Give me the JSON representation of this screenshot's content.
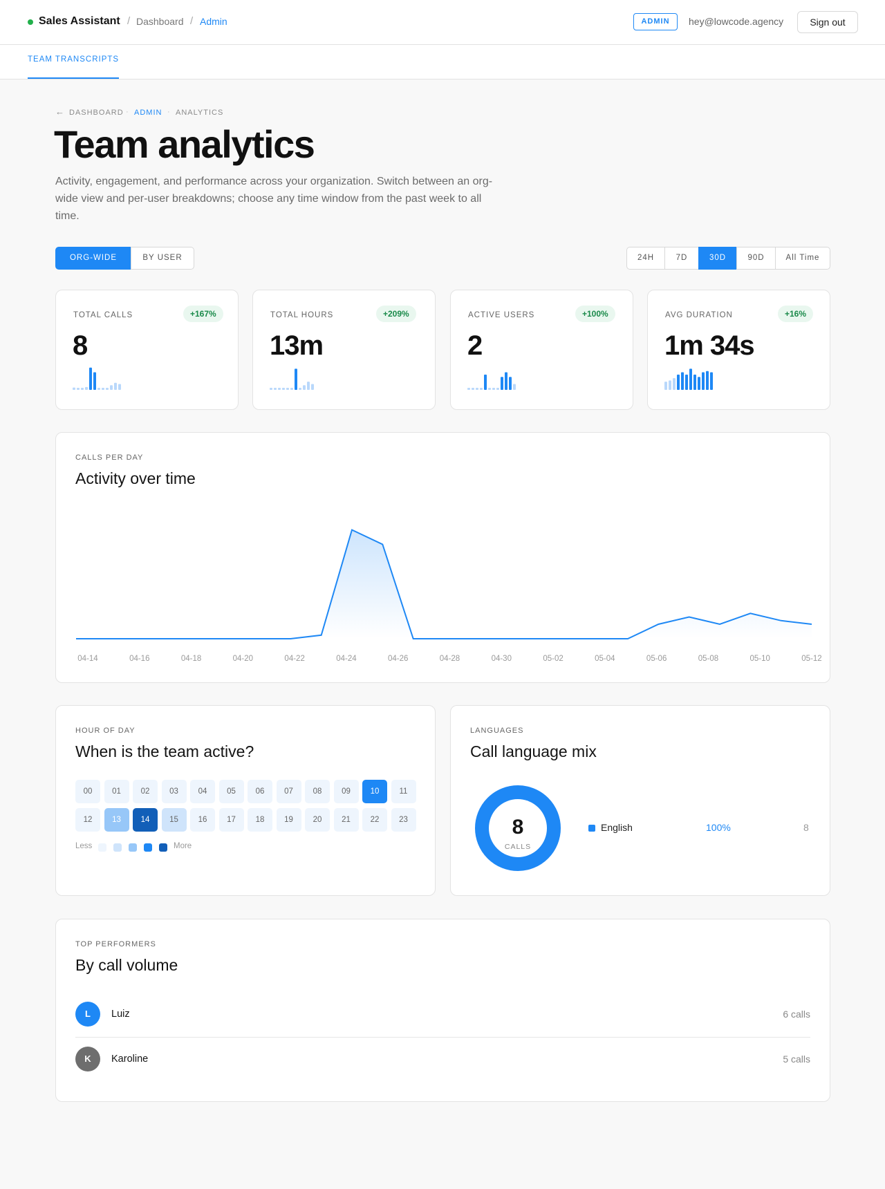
{
  "header": {
    "app_name": "Sales Assistant",
    "breadcrumb": [
      "Dashboard",
      "Admin"
    ],
    "role_badge": "ADMIN",
    "user_email": "hey@lowcode.agency",
    "signout_label": "Sign out"
  },
  "subnav": {
    "tab": "TEAM TRANSCRIPTS"
  },
  "page": {
    "back_arrow": "←",
    "breadcrumb": [
      "DASHBOARD",
      "ADMIN",
      "ANALYTICS"
    ],
    "title": "Team analytics",
    "description": "Activity, engagement, and performance across your organization. Switch between an org-wide view and per-user breakdowns; choose any time window from the past week to all time."
  },
  "view_toggle": {
    "options": [
      "ORG-WIDE",
      "BY USER"
    ],
    "selected": "ORG-WIDE"
  },
  "range_toggle": {
    "options": [
      "24H",
      "7D",
      "30D",
      "90D",
      "All Time"
    ],
    "selected": "30D"
  },
  "kpis": [
    {
      "label": "TOTAL CALLS",
      "delta": "+167%",
      "value": "8",
      "spark": [
        0.1,
        0.05,
        0.05,
        0.12,
        0.95,
        0.75,
        0.05,
        0.05,
        0.05,
        0.2,
        0.3,
        0.25
      ]
    },
    {
      "label": "TOTAL HOURS",
      "delta": "+209%",
      "value": "13m",
      "spark": [
        0.05,
        0.05,
        0.05,
        0.05,
        0.05,
        0.05,
        0.9,
        0.05,
        0.2,
        0.35,
        0.25
      ]
    },
    {
      "label": "ACTIVE USERS",
      "delta": "+100%",
      "value": "2",
      "spark": [
        0.05,
        0.05,
        0.05,
        0.05,
        0.65,
        0.05,
        0.05,
        0.05,
        0.55,
        0.75,
        0.55,
        0.25
      ]
    },
    {
      "label": "AVG DURATION",
      "delta": "+16%",
      "value": "1m 34s",
      "spark": [
        0.35,
        0.4,
        0.5,
        0.65,
        0.75,
        0.65,
        0.9,
        0.65,
        0.55,
        0.75,
        0.8,
        0.75
      ]
    }
  ],
  "activity": {
    "eyebrow": "CALLS PER DAY",
    "title": "Activity over time"
  },
  "chart_data": {
    "type": "area",
    "x": [
      "04-13",
      "04-14",
      "04-15",
      "04-16",
      "04-17",
      "04-18",
      "04-19",
      "04-20",
      "04-21",
      "04-22",
      "04-23",
      "04-24",
      "04-25",
      "04-26",
      "04-27",
      "04-28",
      "04-29",
      "04-30",
      "05-01",
      "05-02",
      "05-03",
      "05-04",
      "05-05",
      "05-06",
      "05-07",
      "05-08",
      "05-09",
      "05-10",
      "05-11",
      "05-12",
      "05-13"
    ],
    "x_ticks": [
      "04-14",
      "04-16",
      "04-18",
      "04-20",
      "04-22",
      "04-24",
      "04-26",
      "04-28",
      "04-30",
      "05-02",
      "05-04",
      "05-06",
      "05-08",
      "05-10",
      "05-12"
    ],
    "values": [
      0,
      0,
      0,
      0,
      0,
      0,
      0,
      0,
      0.1,
      3,
      2.6,
      0,
      0,
      0,
      0,
      0,
      0,
      0,
      0,
      0.4,
      0.6,
      0.4,
      0.7,
      0.5,
      0.4
    ],
    "series_x_index": [
      0,
      1,
      2,
      3,
      4,
      5,
      6,
      7,
      8,
      9,
      10,
      11,
      12,
      13,
      14,
      15,
      16,
      17,
      18,
      19,
      20,
      21,
      22,
      23,
      24
    ],
    "ylim": [
      0,
      3.2
    ],
    "title": "Activity over time",
    "xlabel": "",
    "ylabel": "",
    "grid": false,
    "color": "#1e88f5"
  },
  "hour_of_day": {
    "eyebrow": "HOUR OF DAY",
    "title": "When is the team active?",
    "hours": [
      "00",
      "01",
      "02",
      "03",
      "04",
      "05",
      "06",
      "07",
      "08",
      "09",
      "10",
      "11",
      "12",
      "13",
      "14",
      "15",
      "16",
      "17",
      "18",
      "19",
      "20",
      "21",
      "22",
      "23"
    ],
    "levels": [
      0,
      0,
      0,
      0,
      0,
      0,
      0,
      0,
      0,
      0,
      3,
      0,
      0,
      2,
      4,
      1,
      0,
      0,
      0,
      0,
      0,
      0,
      0,
      0
    ],
    "legend_less": "Less",
    "legend_more": "More",
    "level_colors": [
      "#eef5fd",
      "#cfe4fb",
      "#97c7f8",
      "#1e88f5",
      "#125fb8"
    ]
  },
  "languages": {
    "eyebrow": "LANGUAGES",
    "title": "Call language mix",
    "donut_total": "8",
    "donut_label": "CALLS",
    "items": [
      {
        "name": "English",
        "percent": "100%",
        "count": "8"
      }
    ]
  },
  "top_performers": {
    "eyebrow": "TOP PERFORMERS",
    "title": "By call volume",
    "rows": [
      {
        "initial": "L",
        "name": "Luiz",
        "calls": "6 calls",
        "color": "#1e88f5"
      },
      {
        "initial": "K",
        "name": "Karoline",
        "calls": "5 calls",
        "color": "#6e6e6e"
      }
    ]
  }
}
